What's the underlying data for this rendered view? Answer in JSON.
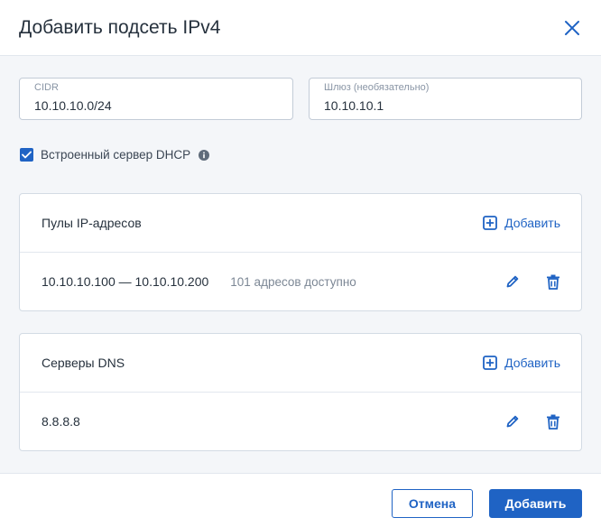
{
  "dialog": {
    "title": "Добавить подсеть IPv4",
    "close_icon": "close-icon"
  },
  "fields": {
    "cidr": {
      "label": "CIDR",
      "value": "10.10.10.0/24"
    },
    "gateway": {
      "label": "Шлюз (необязательно)",
      "value": "10.10.10.1"
    }
  },
  "dhcp": {
    "checked": true,
    "label": "Встроенный сервер DHCP",
    "info_icon": "info-icon"
  },
  "pools": {
    "title": "Пулы IP-адресов",
    "add_label": "Добавить",
    "items": [
      {
        "range": "10.10.10.100 — 10.10.10.200",
        "available": "101 адресов доступно"
      }
    ]
  },
  "dns": {
    "title": "Серверы DNS",
    "add_label": "Добавить",
    "items": [
      {
        "address": "8.8.8.8"
      }
    ]
  },
  "footer": {
    "cancel_label": "Отмена",
    "add_label": "Добавить"
  },
  "colors": {
    "accent": "#1f63c4",
    "body_bg": "#f4f6f9",
    "border": "#c3ccd7",
    "text": "#26313d",
    "muted": "#7c8795"
  }
}
